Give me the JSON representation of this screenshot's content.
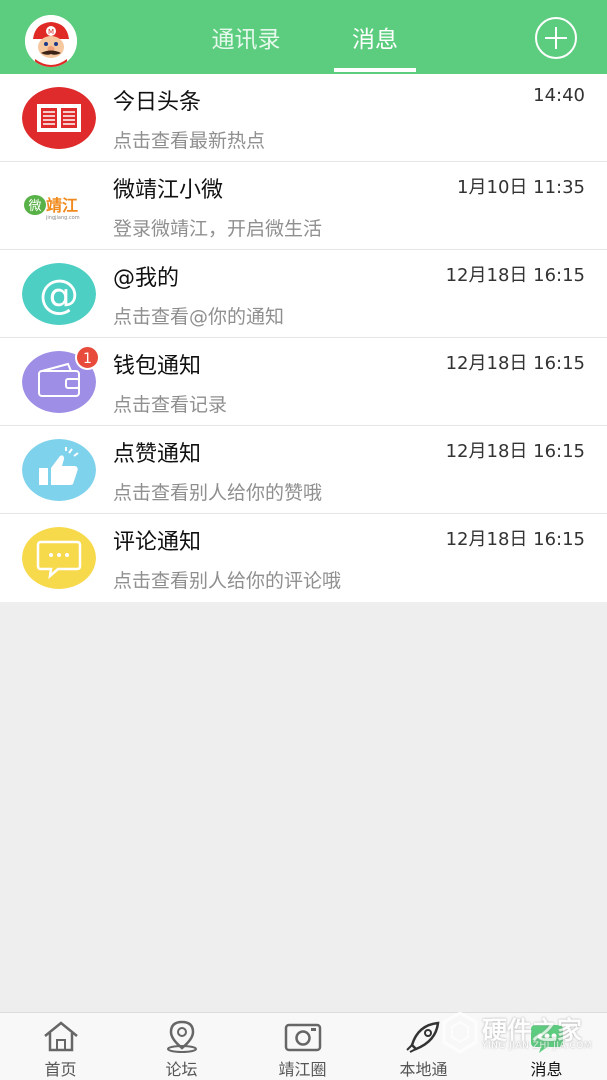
{
  "header": {
    "tabs": [
      {
        "label": "通讯录",
        "active": false
      },
      {
        "label": "消息",
        "active": true
      }
    ],
    "accent": "#5ccd7f",
    "add_icon": "plus-circle-icon"
  },
  "messages": [
    {
      "title": "今日头条",
      "subtitle": "点击查看最新热点",
      "time": "14:40",
      "icon": "news-icon"
    },
    {
      "title": "微靖江小微",
      "subtitle": "登录微靖江，开启微生活",
      "time": "1月10日 11:35",
      "icon": "weijingjiang-logo",
      "logo_text": "微靖江",
      "logo_sub": "jingjiang.com"
    },
    {
      "title": "@我的",
      "subtitle": "点击查看@你的通知",
      "time": "12月18日 16:15",
      "icon": "at-icon"
    },
    {
      "title": "钱包通知",
      "subtitle": "点击查看记录",
      "time": "12月18日 16:15",
      "icon": "wallet-icon",
      "badge": "1"
    },
    {
      "title": "点赞通知",
      "subtitle": "点击查看别人给你的赞哦",
      "time": "12月18日 16:15",
      "icon": "thumbs-up-icon"
    },
    {
      "title": "评论通知",
      "subtitle": "点击查看别人给你的评论哦",
      "time": "12月18日 16:15",
      "icon": "comment-icon"
    }
  ],
  "bottom_nav": [
    {
      "label": "首页",
      "icon": "home-icon",
      "active": false
    },
    {
      "label": "论坛",
      "icon": "location-pin-icon",
      "active": false
    },
    {
      "label": "靖江圈",
      "icon": "camera-icon",
      "active": false
    },
    {
      "label": "本地通",
      "icon": "rocket-icon",
      "active": false
    },
    {
      "label": "消息",
      "icon": "message-icon",
      "active": true
    }
  ],
  "watermark": {
    "text": "硬件之家",
    "sub": "YING JIAN ZHI JIA.COM"
  }
}
